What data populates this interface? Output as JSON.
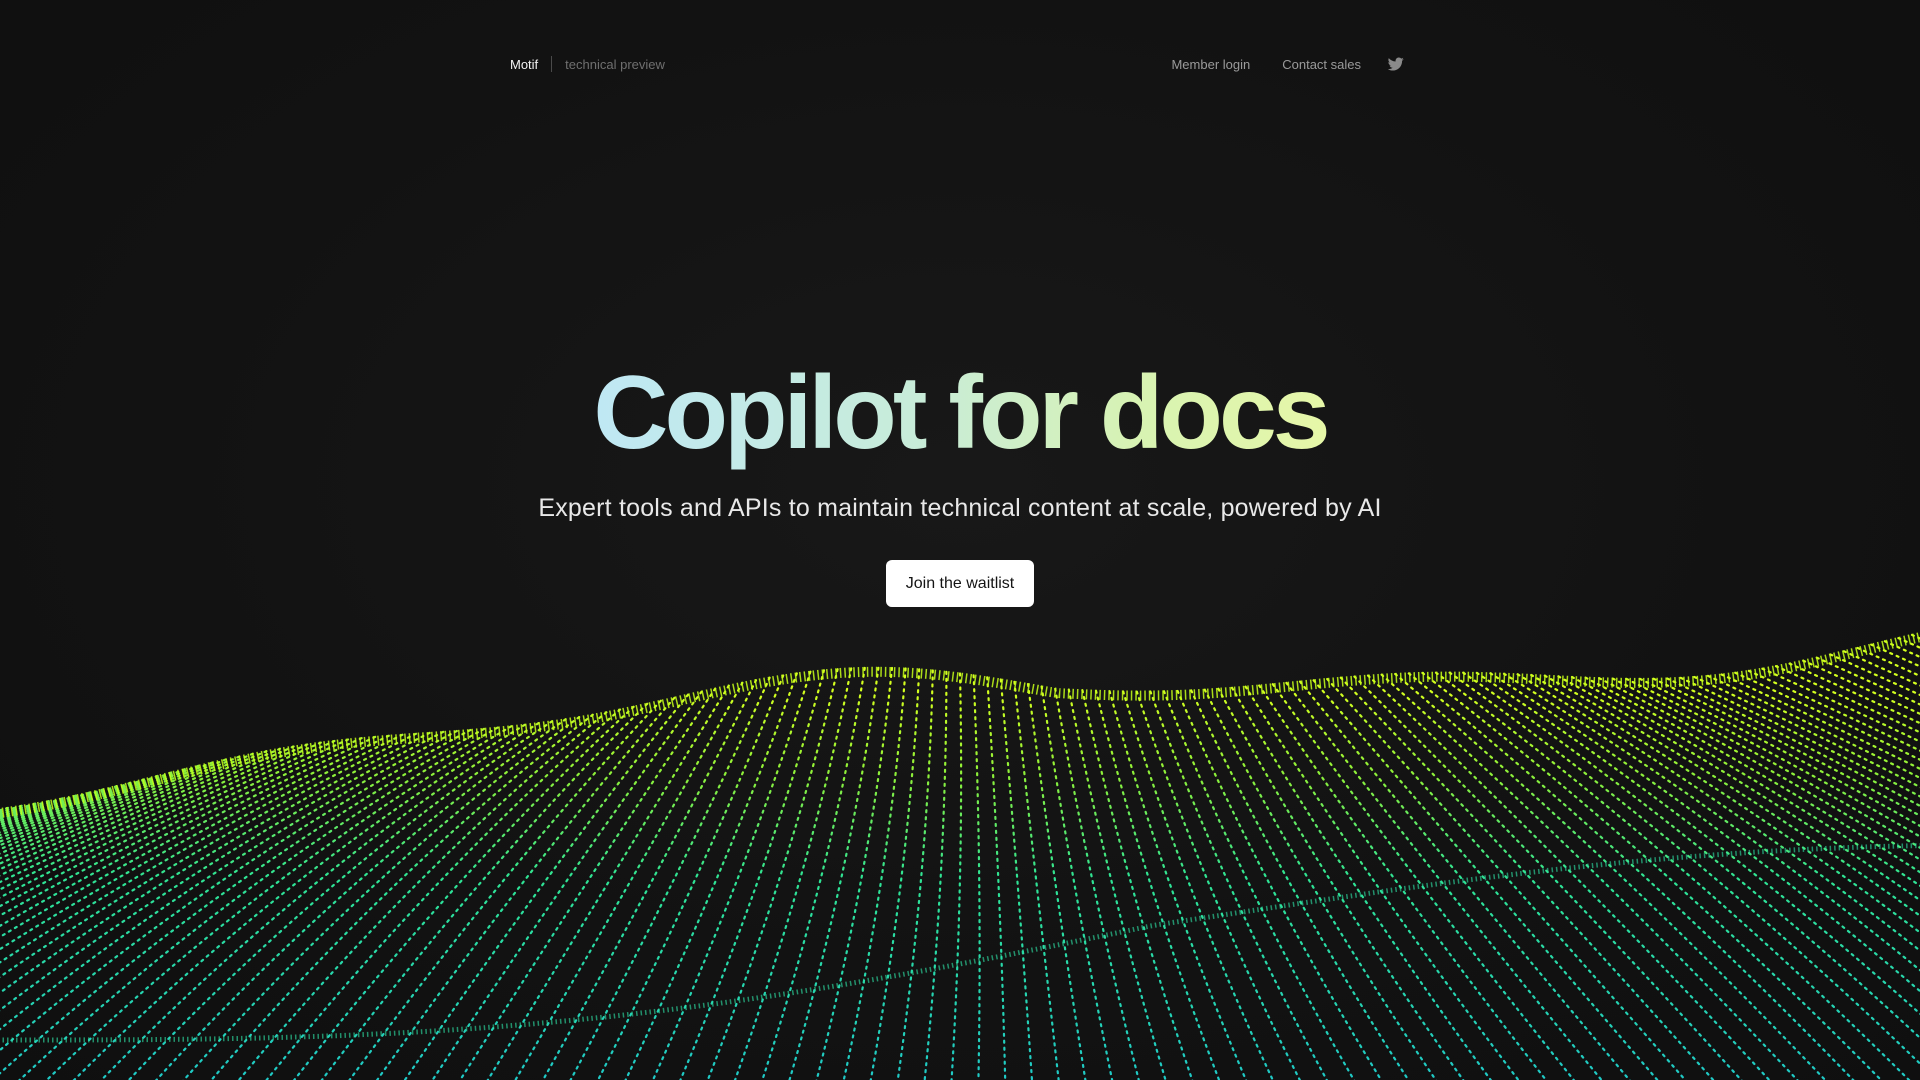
{
  "nav": {
    "brand": "Motif",
    "tagline": "technical preview",
    "links": {
      "member_login": "Member login",
      "contact_sales": "Contact sales"
    },
    "social_icon": "twitter-icon"
  },
  "hero": {
    "headline": "Copilot for docs",
    "subtitle": "Expert tools and APIs to maintain technical content at scale, powered by AI",
    "cta_label": "Join the waitlist"
  },
  "colors": {
    "background": "#141414",
    "wave_top": "#d4ff1e",
    "wave_bottom": "#25d8c8",
    "headline_start": "#bfe8f4",
    "headline_end": "#e6f7a8",
    "cta_background": "#ffffff"
  }
}
